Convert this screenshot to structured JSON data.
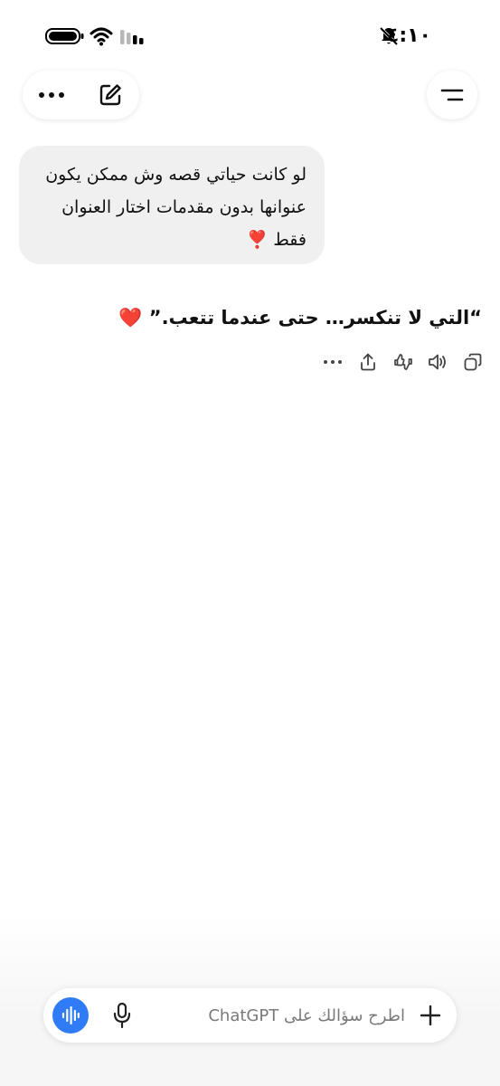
{
  "status_bar": {
    "time": "٤:١٠",
    "icons": [
      "bell-slash-icon",
      "battery-icon",
      "wifi-icon",
      "cellular-signal-icon"
    ]
  },
  "header": {
    "left_icons": [
      "more-icon",
      "new-chat-icon"
    ],
    "right_icon": "menu-icon"
  },
  "conversation": {
    "user_message": "لو كانت حياتي قصه وش ممكن يكون عنوانها بدون مقدمات اختار العنوان فقط ❣️",
    "assistant_message": "“التي لا تنكسر… حتى عندما تتعب.”",
    "assistant_emoji": "❤️",
    "action_icons": [
      "copy-icon",
      "speaker-icon",
      "thumbs-feedback-icon",
      "share-icon",
      "more-icon"
    ]
  },
  "composer": {
    "placeholder": "اطرح سؤالك على ChatGPT",
    "voice_color": "#2f7cf6"
  }
}
